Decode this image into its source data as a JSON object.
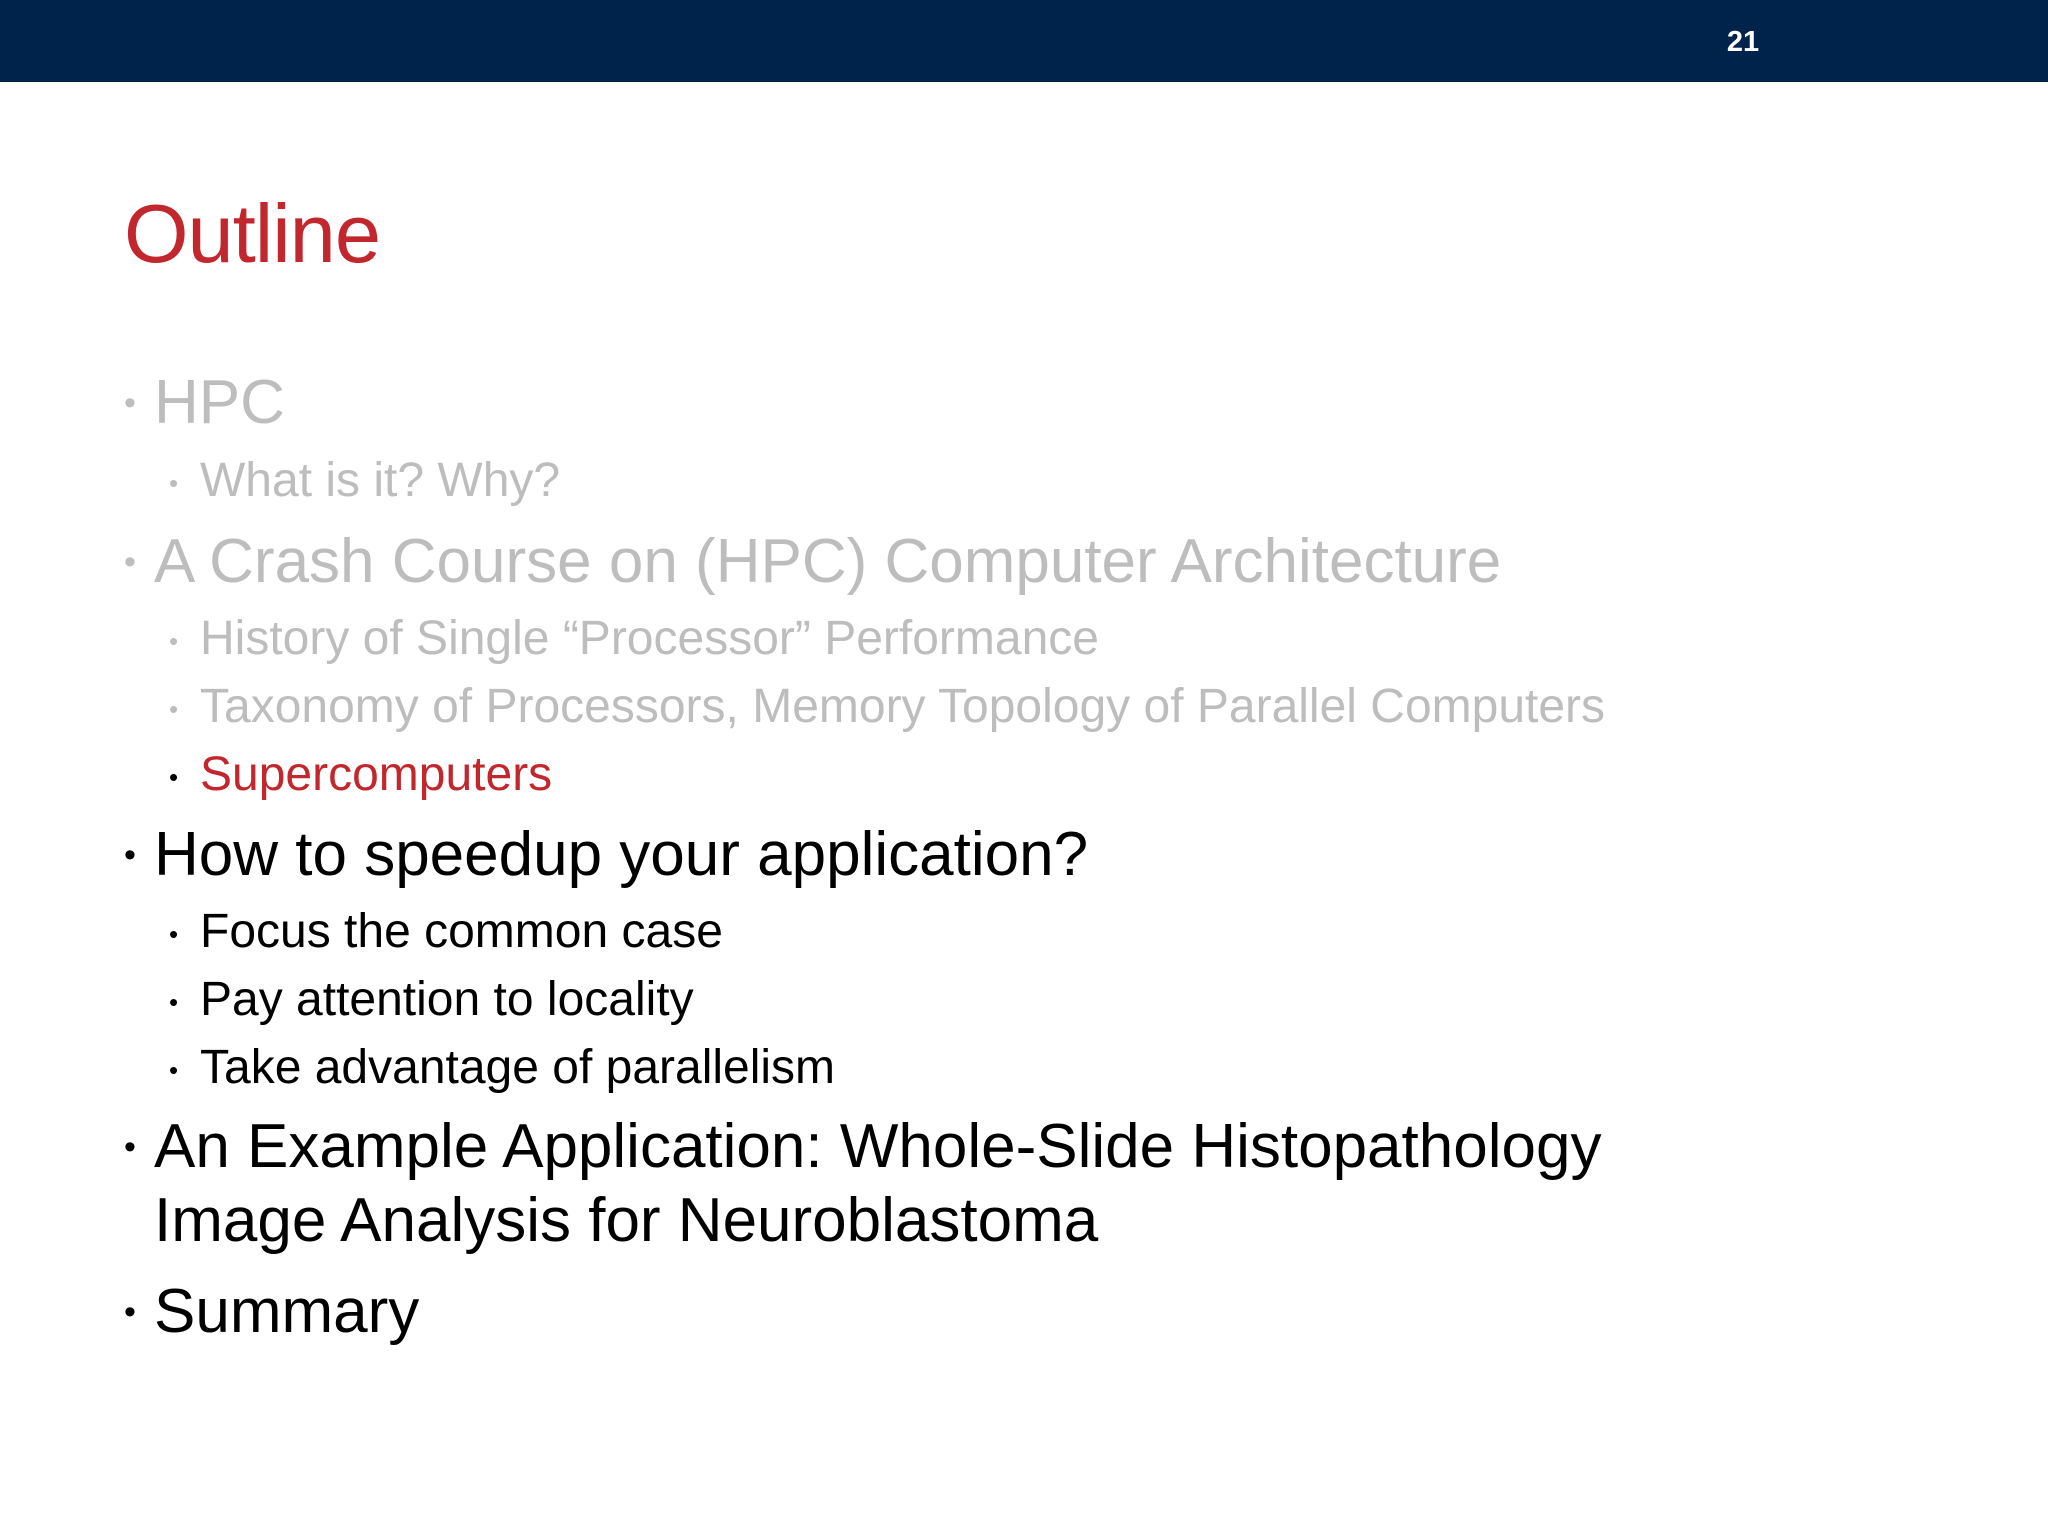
{
  "header": {
    "page_number": "21",
    "bar_color": "#00234c"
  },
  "slide": {
    "title": "Outline",
    "title_color": "#c1272d"
  },
  "bullet_glyph": "•",
  "outline": {
    "hpc": "HPC",
    "what_is_it": "What is it? Why?",
    "crash_course": "A Crash Course on (HPC) Computer Architecture",
    "history": "History of Single “Processor” Performance",
    "taxonomy": "Taxonomy of Processors, Memory Topology of Parallel Computers",
    "supercomputers": "Supercomputers",
    "speedup": "How to speedup your application?",
    "focus": "Focus the common case",
    "locality": "Pay attention to locality",
    "parallelism": "Take advantage of parallelism",
    "example_line1": "An Example Application: Whole-Slide Histopathology",
    "example_line2": "Image Analysis for Neuroblastoma",
    "summary": "Summary"
  },
  "colors": {
    "past_items": "#bdbdbd",
    "current_item": "#c1272d",
    "upcoming_items": "#000000"
  }
}
